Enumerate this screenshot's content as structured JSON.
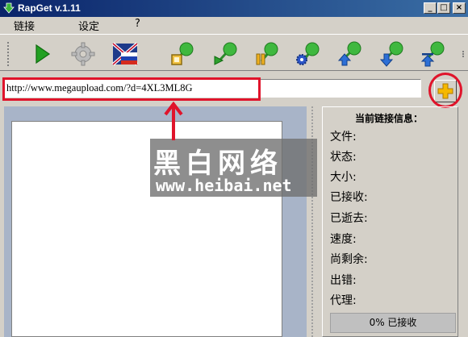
{
  "window": {
    "title": "RapGet v.1.11"
  },
  "menu": {
    "items": [
      "链接",
      "设定",
      "?"
    ]
  },
  "url_field": {
    "value": "http://www.megaupload.com/?d=4XL3ML8G"
  },
  "info_panel": {
    "title": "当前链接信息：",
    "labels": [
      "文件:",
      "状态:",
      "大小:",
      "已接收:",
      "已逝去:",
      "速度:",
      "尚剩余:",
      "出错:",
      "代理:"
    ]
  },
  "progress": {
    "text": "0% 已接收",
    "value": 0
  },
  "watermark": {
    "line1": "黑白网络",
    "line2": "www.heibai.net"
  },
  "colors": {
    "titlebar": "#0a246a",
    "annotation": "#e0142b",
    "panel": "#a8b4c8",
    "add_plus": "#f5b800"
  },
  "toolbar": {
    "buttons": [
      "play-icon",
      "settings-gear-icon",
      "language-flag-icon",
      "stop-icon",
      "resume-icon",
      "pause-icon",
      "config-icon",
      "move-up-icon",
      "move-down-icon",
      "move-top-icon"
    ]
  }
}
